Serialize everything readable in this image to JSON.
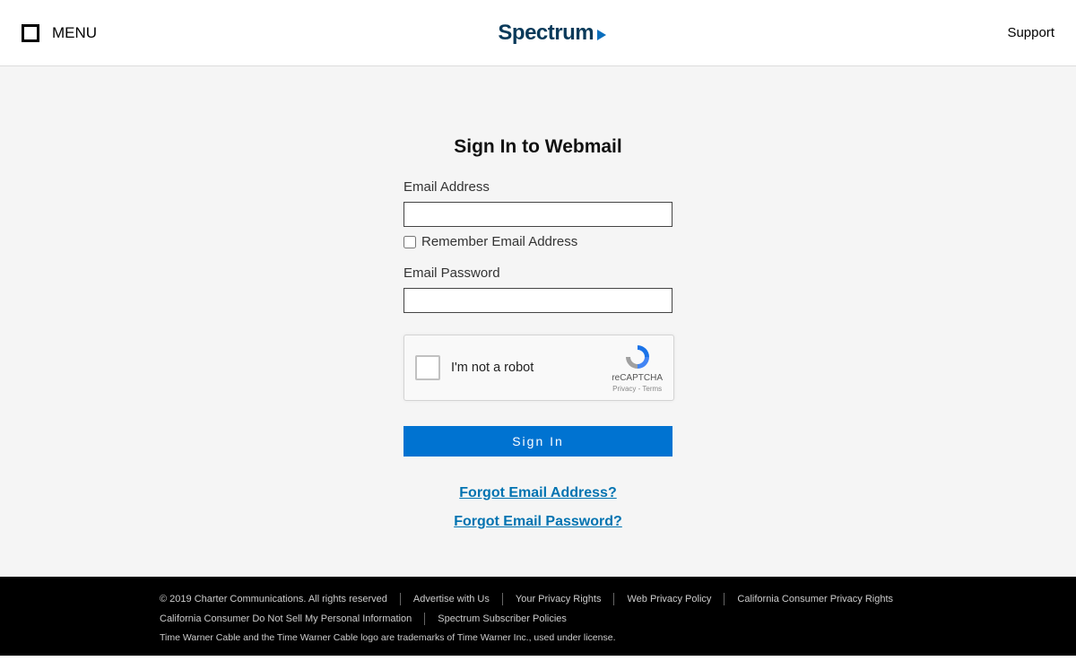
{
  "header": {
    "menu_label": "MENU",
    "logo_text": "Spectrum",
    "support_label": "Support"
  },
  "form": {
    "title": "Sign In to Webmail",
    "email_label": "Email Address",
    "email_value": "",
    "remember_label": "Remember Email Address",
    "password_label": "Email Password",
    "password_value": "",
    "recaptcha_label": "I'm not a robot",
    "recaptcha_brand": "reCAPTCHA",
    "recaptcha_legal": "Privacy - Terms",
    "signin_label": "Sign In",
    "forgot_email": "Forgot Email Address?",
    "forgot_password": "Forgot Email Password?"
  },
  "footer": {
    "copyright": "© 2019 Charter Communications. All rights reserved",
    "links_row1": [
      "Advertise with Us",
      "Your Privacy Rights",
      "Web Privacy Policy",
      "California Consumer Privacy Rights"
    ],
    "links_row2": [
      "California Consumer Do Not Sell My Personal Information",
      "Spectrum Subscriber Policies"
    ],
    "trademark": "Time Warner Cable and the Time Warner Cable logo are trademarks of Time Warner Inc., used under license."
  }
}
